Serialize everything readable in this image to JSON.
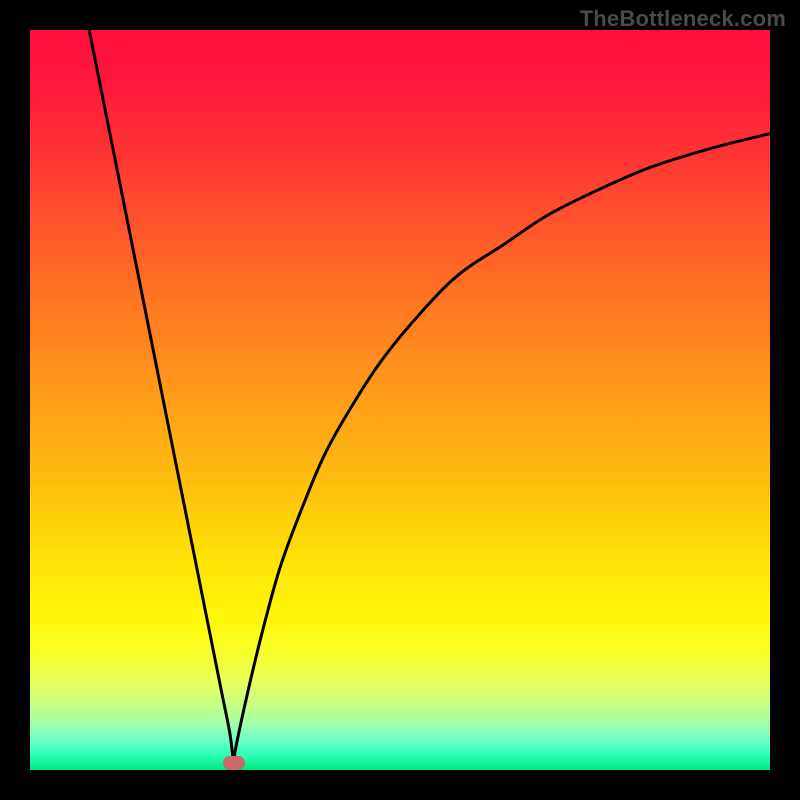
{
  "watermark": {
    "text": "TheBottleneck.com"
  },
  "colors": {
    "frame": "#000000",
    "curve": "#000000",
    "marker": "#c86a69",
    "gradient_top": "#ff0e3f",
    "gradient_bottom": "#02e884"
  },
  "chart_data": {
    "type": "line",
    "title": "",
    "xlabel": "",
    "ylabel": "",
    "xlim": [
      0,
      100
    ],
    "ylim": [
      0,
      100
    ],
    "grid": false,
    "legend": false,
    "marker": {
      "x": 27.5,
      "y": 1.0
    },
    "series": [
      {
        "name": "left-branch",
        "x": [
          8,
          10,
          12,
          14,
          16,
          18,
          20,
          22,
          24,
          25,
          26,
          27,
          27.5
        ],
        "values": [
          100,
          90,
          80,
          70,
          60,
          50,
          40,
          30,
          20,
          15,
          10,
          5,
          1.0
        ]
      },
      {
        "name": "right-branch",
        "x": [
          27.5,
          28,
          30,
          32,
          34,
          37,
          40,
          44,
          48,
          53,
          58,
          64,
          70,
          77,
          84,
          92,
          100
        ],
        "values": [
          1.0,
          4,
          13,
          21,
          28,
          36,
          43,
          50,
          56,
          62,
          67,
          71,
          75,
          78.5,
          81.5,
          84,
          86
        ]
      }
    ]
  }
}
